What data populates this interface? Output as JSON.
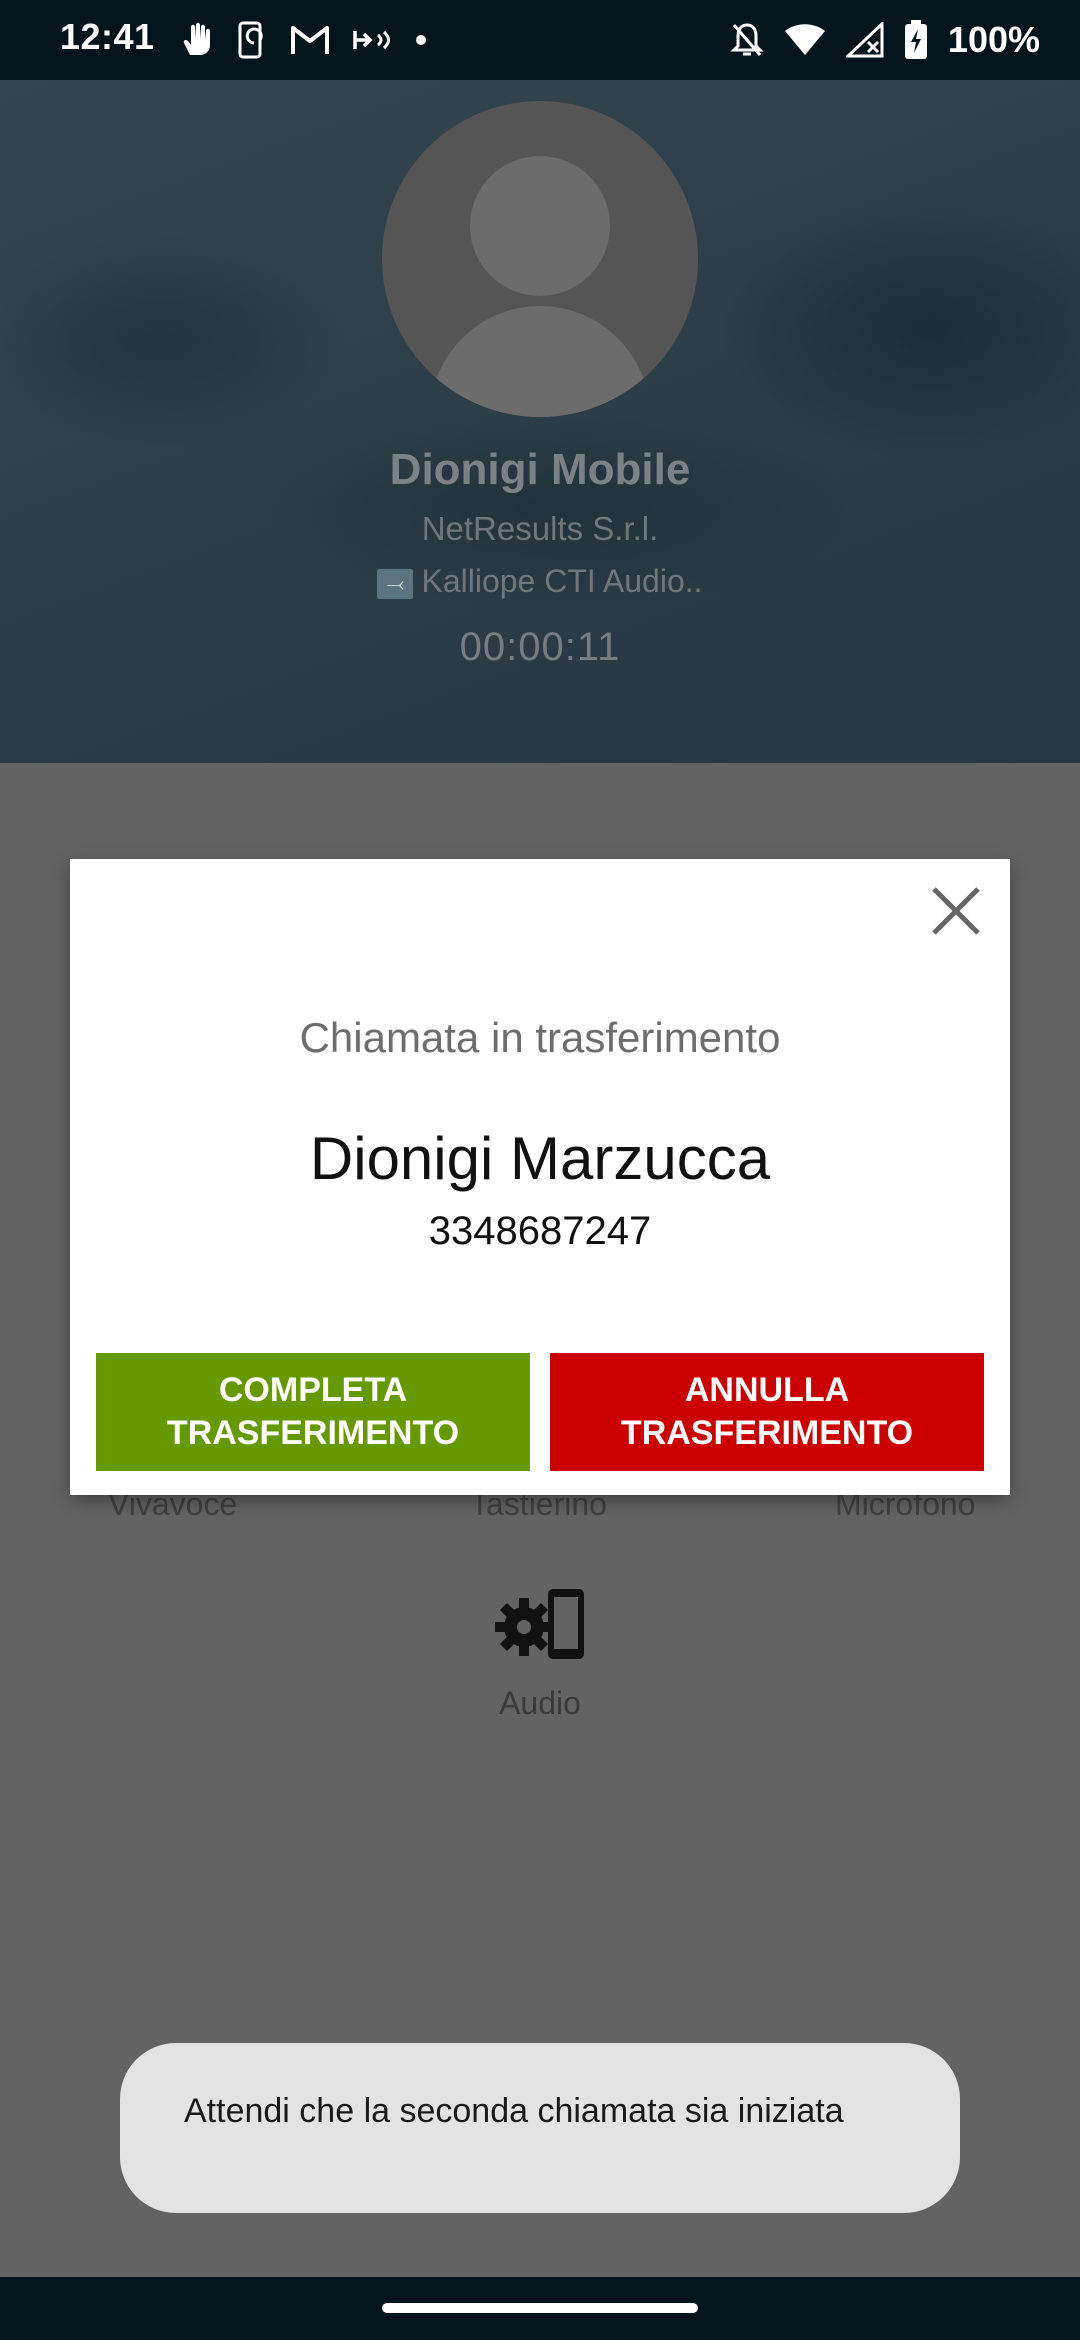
{
  "status_bar": {
    "time": "12:41",
    "left_icons": [
      "hand-icon",
      "phone-sync-icon",
      "gmail-icon",
      "link-icon",
      "dot-icon"
    ],
    "right_icons": [
      "bell-off-icon",
      "wifi-icon",
      "signal-off-icon",
      "battery-charging-icon"
    ],
    "battery": "100%"
  },
  "call": {
    "name": "Dionigi Mobile",
    "company": "NetResults S.r.l.",
    "line": "Kalliope CTI Audio..",
    "timer": "00:00:11"
  },
  "controls": {
    "speaker": "Vivavoce",
    "keypad": "Tastierino",
    "microphone": "Microfono",
    "audio": "Audio"
  },
  "dialog": {
    "title": "Chiamata in trasferimento",
    "contact_name": "Dionigi Marzucca",
    "contact_number": "3348687247",
    "complete_label": "COMPLETA TRASFERIMENTO",
    "cancel_label": "ANNULLA TRASFERIMENTO"
  },
  "toast": {
    "message": "Attendi che la seconda chiamata sia iniziata"
  },
  "colors": {
    "complete": "#669900",
    "cancel": "#cc0000",
    "status_bar": "#04141b"
  }
}
